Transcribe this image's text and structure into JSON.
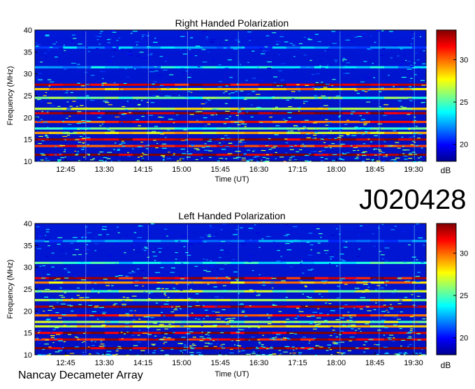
{
  "observation_id": "J020428",
  "instrument": "Nancay Decameter Array",
  "colorbar_stops": [
    "#00008f",
    "#0000ff",
    "#0080ff",
    "#00ffff",
    "#80ff80",
    "#ffff00",
    "#ff8000",
    "#ff0000",
    "#800000"
  ],
  "chart_data": [
    {
      "type": "heatmap",
      "title": "Right Handed Polarization",
      "xlabel": "Time (UT)",
      "ylabel": "Frequency (MHz)",
      "x_ticks": [
        "12:45",
        "13:30",
        "14:15",
        "15:00",
        "15:45",
        "16:30",
        "17:15",
        "18:00",
        "18:45",
        "19:30"
      ],
      "y_ticks": [
        "10",
        "15",
        "20",
        "25",
        "30",
        "35",
        "40"
      ],
      "ylim": [
        10,
        40
      ],
      "colorbar": {
        "label": "dB",
        "ticks": [
          "20",
          "25",
          "30"
        ],
        "range": [
          18,
          33.5
        ]
      },
      "bands": [
        {
          "freq": 11.5,
          "level": 33
        },
        {
          "freq": 13.5,
          "level": 31
        },
        {
          "freq": 15.0,
          "level": 33
        },
        {
          "freq": 16.5,
          "level": 28
        },
        {
          "freq": 17.5,
          "level": 25
        },
        {
          "freq": 19.0,
          "level": 31
        },
        {
          "freq": 21.0,
          "level": 33
        },
        {
          "freq": 22.0,
          "level": 27
        },
        {
          "freq": 24.5,
          "level": 25
        },
        {
          "freq": 26.5,
          "level": 29
        },
        {
          "freq": 27.5,
          "level": 32
        },
        {
          "freq": 31.5,
          "level": 23
        },
        {
          "freq": 36.0,
          "level": 22
        }
      ]
    },
    {
      "type": "heatmap",
      "title": "Left Handed Polarization",
      "xlabel": "Time (UT)",
      "ylabel": "Frequency (MHz)",
      "x_ticks": [
        "12:45",
        "13:30",
        "14:15",
        "15:00",
        "15:45",
        "16:30",
        "17:15",
        "18:00",
        "18:45",
        "19:30"
      ],
      "y_ticks": [
        "10",
        "15",
        "20",
        "25",
        "30",
        "35",
        "40"
      ],
      "ylim": [
        10,
        40
      ],
      "colorbar": {
        "label": "dB",
        "ticks": [
          "20",
          "25",
          "30"
        ],
        "range": [
          18,
          33.5
        ]
      },
      "bands": [
        {
          "freq": 11.5,
          "level": 33
        },
        {
          "freq": 13.5,
          "level": 32
        },
        {
          "freq": 15.0,
          "level": 33
        },
        {
          "freq": 16.5,
          "level": 28
        },
        {
          "freq": 17.5,
          "level": 26
        },
        {
          "freq": 19.0,
          "level": 31
        },
        {
          "freq": 21.0,
          "level": 33
        },
        {
          "freq": 22.5,
          "level": 27
        },
        {
          "freq": 24.5,
          "level": 26
        },
        {
          "freq": 26.5,
          "level": 29
        },
        {
          "freq": 27.5,
          "level": 32
        },
        {
          "freq": 31.0,
          "level": 24
        },
        {
          "freq": 36.0,
          "level": 22
        }
      ]
    }
  ]
}
